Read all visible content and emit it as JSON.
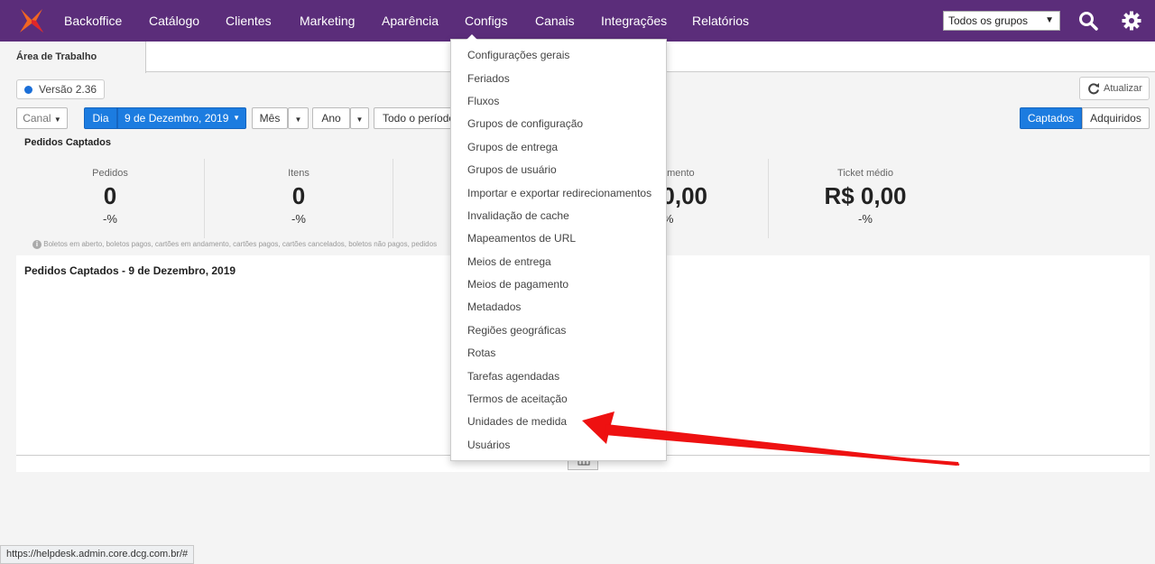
{
  "nav": {
    "items": [
      "Backoffice",
      "Catálogo",
      "Clientes",
      "Marketing",
      "Aparência",
      "Configs",
      "Canais",
      "Integrações",
      "Relatórios"
    ],
    "group_select": "Todos os grupos",
    "colors": {
      "bar": "#5b2d7a",
      "logo_orange": "#f26522",
      "logo_red": "#e0262b"
    }
  },
  "tabs": {
    "active": "Área de Trabalho"
  },
  "version": "Versão 2.36",
  "refresh_label": "Atualizar",
  "filters": {
    "canal": "Canal",
    "dia": "Dia",
    "date": "9 de Dezembro, 2019",
    "mes": "Mês",
    "ano": "Ano",
    "periodo": "Todo o período",
    "captados": "Captados",
    "adquiridos": "Adquiridos"
  },
  "section_title": "Pedidos Captados",
  "stats": [
    {
      "label": "Pedidos",
      "value": "0",
      "pct": "-%"
    },
    {
      "label": "Itens",
      "value": "0",
      "pct": "-%"
    },
    {
      "label": "Faturamento",
      "value": "R$ 0,00",
      "pct": "-%"
    },
    {
      "label": "Ticket médio",
      "value": "R$ 0,00",
      "pct": "-%"
    }
  ],
  "info_note": "Boletos em aberto, boletos pagos, cartões em andamento, cartões pagos, cartões cancelados, boletos não pagos, pedidos",
  "panel_title": "Pedidos Captados - 9 de Dezembro, 2019",
  "menu": {
    "items": [
      "Configurações gerais",
      "Feriados",
      "Fluxos",
      "Grupos de configuração",
      "Grupos de entrega",
      "Grupos de usuário",
      "Importar e exportar redirecionamentos",
      "Invalidação de cache",
      "Mapeamentos de URL",
      "Meios de entrega",
      "Meios de pagamento",
      "Metadados",
      "Regiões geográficas",
      "Rotas",
      "Tarefas agendadas",
      "Termos de aceitação",
      "Unidades de medida",
      "Usuários"
    ],
    "highlighted": "Unidades de medida"
  },
  "status_url": "https://helpdesk.admin.core.dcg.com.br/#",
  "annotation": {
    "arrow_color": "#ee1111"
  }
}
